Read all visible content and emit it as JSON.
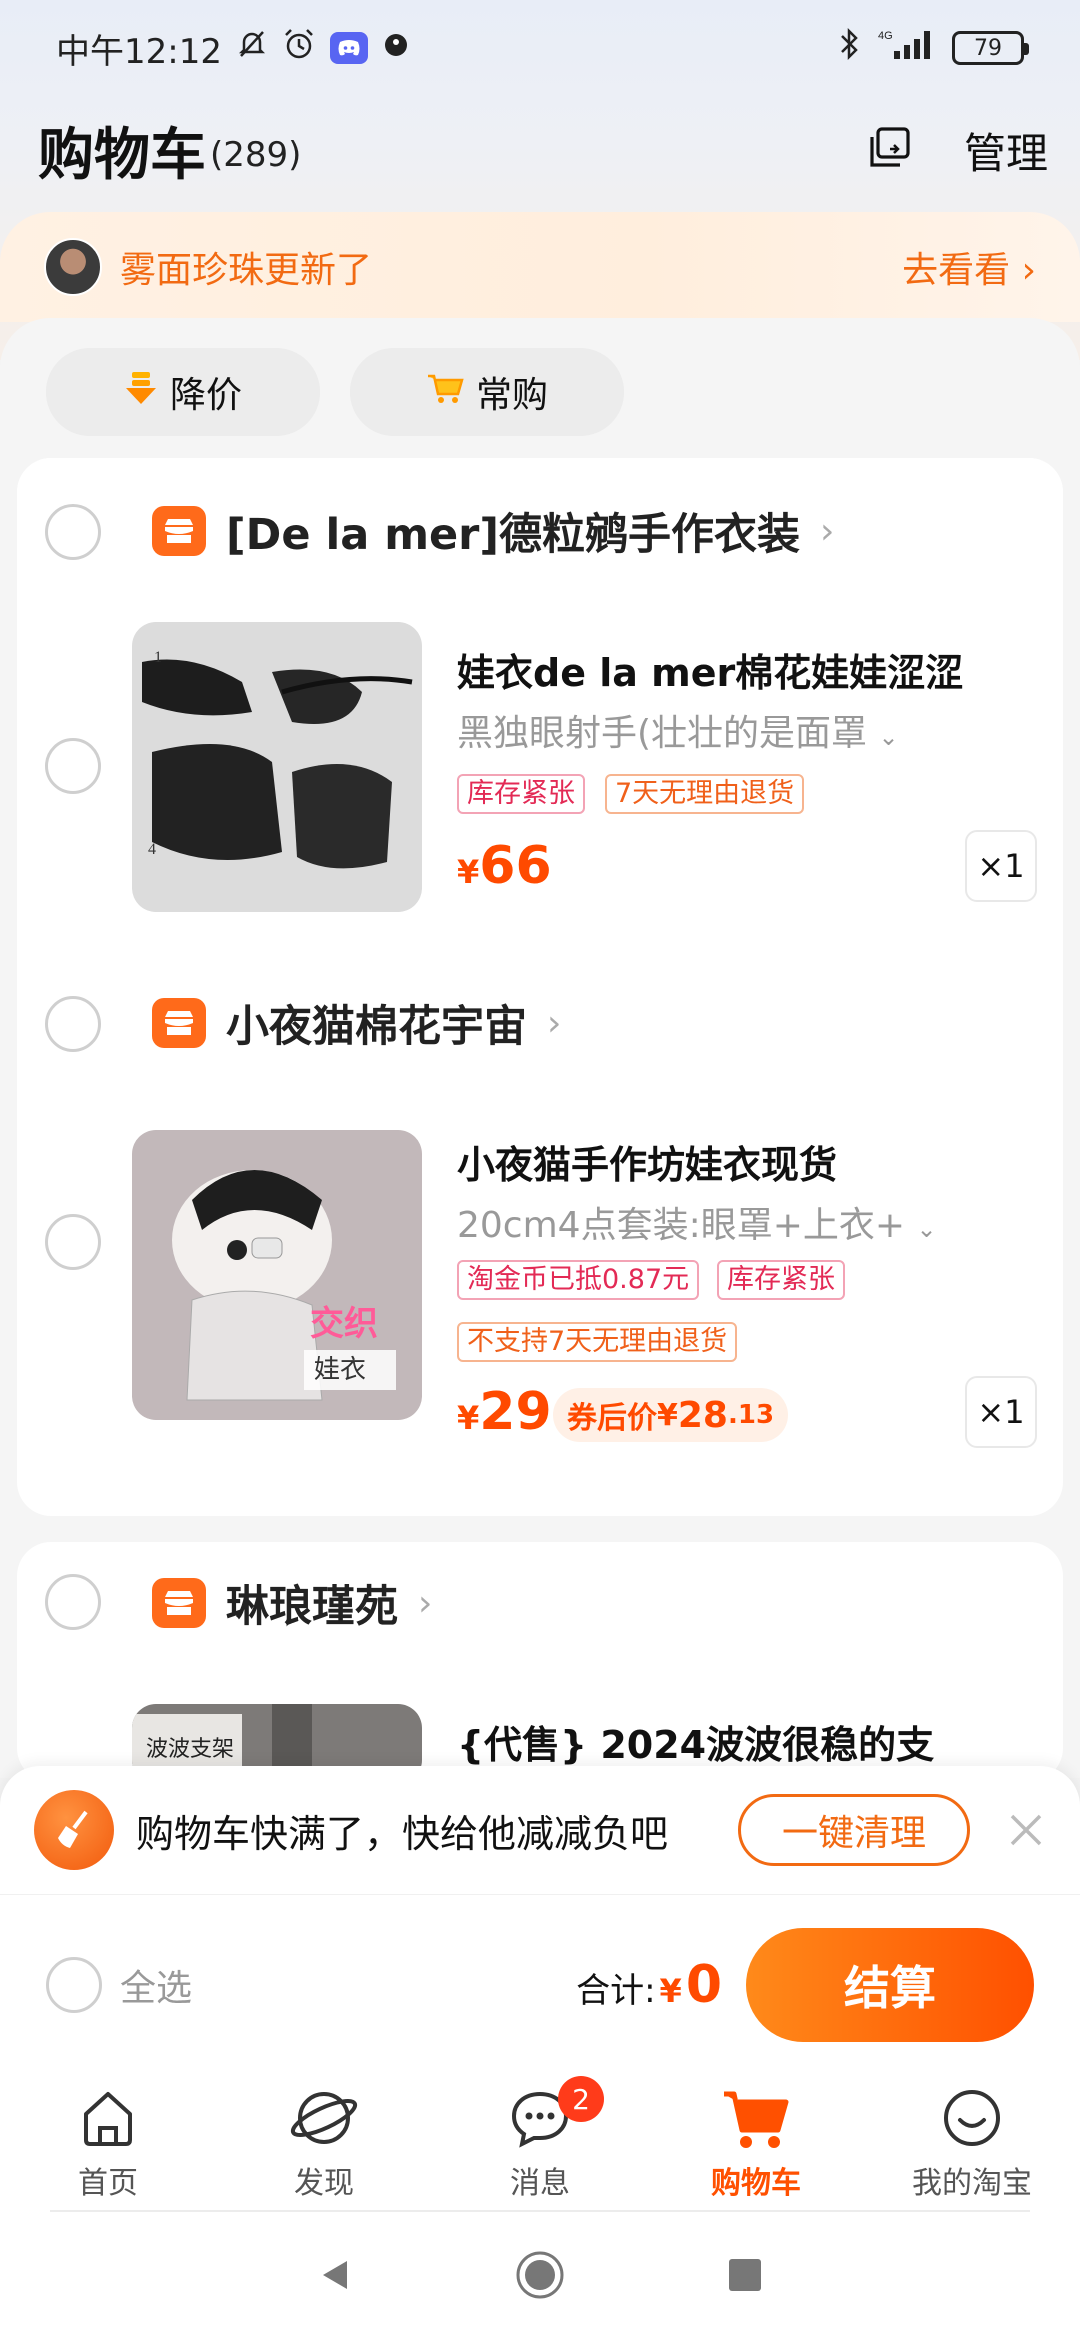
{
  "status_bar": {
    "time": "中午12:12",
    "network": "4G",
    "battery": "79"
  },
  "header": {
    "title": "购物车",
    "count": "(289)",
    "manage_label": "管理"
  },
  "notify": {
    "text": "雾面珍珠更新了",
    "link": "去看看"
  },
  "filters": [
    {
      "label": "降价",
      "icon": "price-drop-icon"
    },
    {
      "label": "常购",
      "icon": "cart-icon"
    }
  ],
  "shops": [
    {
      "name": "[De la mer]德粒鹓手作衣装",
      "item": {
        "title": "娃衣de la mer棉花娃娃涩涩",
        "sku": "黑独眼射手(壮壮的是面罩",
        "tags": [
          "库存紧张",
          "7天无理由退货"
        ],
        "price_currency": "¥",
        "price": "66",
        "qty": "×1"
      }
    },
    {
      "name": "小夜猫棉花宇宙",
      "item": {
        "title": "小夜猫手作坊娃衣现货",
        "sku": "20cm4点套装:眼罩+上衣+",
        "tags": [
          "淘金币已抵0.87元",
          "库存紧张",
          "不支持7天无理由退货"
        ],
        "price_currency": "¥",
        "price": "29",
        "coupon_label": "券后价",
        "coupon_currency": "¥",
        "coupon_int": "28",
        "coupon_dec": ".13",
        "qty": "×1",
        "image_text": "交织",
        "image_subtext": "娃衣"
      }
    },
    {
      "name": "琳琅瑾苑",
      "item": {
        "title": "{代售} 2024波波很稳的支",
        "image_text": "波波支架"
      }
    }
  ],
  "cleanup": {
    "text": "购物车快满了，快给他减减负吧",
    "button": "一键清理"
  },
  "checkout": {
    "select_all": "全选",
    "total_label": "合计:",
    "total_currency": "¥",
    "total_amount": "0",
    "button": "结算"
  },
  "tabs": [
    {
      "label": "首页",
      "icon": "home-icon"
    },
    {
      "label": "发现",
      "icon": "planet-icon"
    },
    {
      "label": "消息",
      "icon": "chat-icon",
      "badge": "2"
    },
    {
      "label": "购物车",
      "icon": "shopping-cart-icon",
      "active": true
    },
    {
      "label": "我的淘宝",
      "icon": "smile-icon"
    }
  ],
  "colors": {
    "accent": "#ff5000",
    "notify": "#f26a12",
    "tag_red": "#e32a55",
    "tag_orange": "#f0601a"
  }
}
